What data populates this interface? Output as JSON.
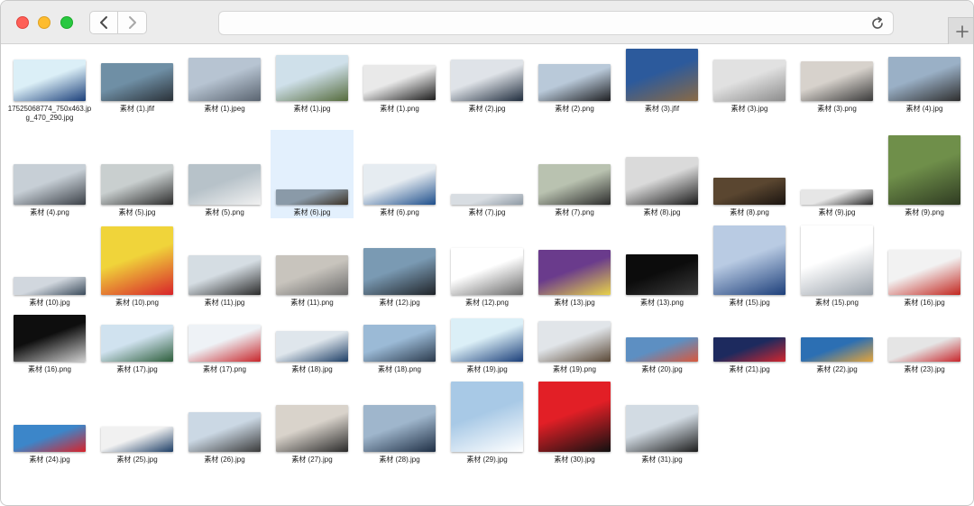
{
  "window": {
    "buttons": [
      "close",
      "minimize",
      "zoom"
    ],
    "back_icon": "chevron-left-icon",
    "forward_icon": "chevron-right-icon",
    "reload_icon": "reload-icon",
    "new_tab_icon": "plus-icon",
    "url": ""
  },
  "files": [
    {
      "name": "17525068774_750x463.jpg_470_290.jpg",
      "colors": [
        "#dbeff7",
        "#1b3f7a"
      ]
    },
    {
      "name": "素材 (1).jfif",
      "colors": [
        "#6f8fa5",
        "#2a3138"
      ]
    },
    {
      "name": "素材 (1).jpeg",
      "colors": [
        "#b7c4d2",
        "#5a6470"
      ]
    },
    {
      "name": "素材 (1).jpg",
      "colors": [
        "#cfe0ea",
        "#556b3c"
      ]
    },
    {
      "name": "素材 (1).png",
      "colors": [
        "#e9e9e9",
        "#1c1c1c"
      ]
    },
    {
      "name": "素材 (2).jpg",
      "colors": [
        "#dfe3e8",
        "#1f2c3d"
      ]
    },
    {
      "name": "素材 (2).png",
      "colors": [
        "#b9c9d9",
        "#1e1f22"
      ]
    },
    {
      "name": "素材 (3).jfif",
      "colors": [
        "#2c5a9c",
        "#8a6a45"
      ]
    },
    {
      "name": "素材 (3).jpg",
      "colors": [
        "#e1e1e1",
        "#8c8c8c"
      ]
    },
    {
      "name": "素材 (3).png",
      "colors": [
        "#d7d2cc",
        "#3a3a3a"
      ]
    },
    {
      "name": "素材 (4).jpg",
      "colors": [
        "#9ab0c6",
        "#2e2e2e"
      ]
    },
    {
      "name": "素材 (4).png",
      "colors": [
        "#c7cfd6",
        "#3b4047"
      ]
    },
    {
      "name": "素材 (5).jpg",
      "colors": [
        "#c9cfcf",
        "#2d2d2d"
      ]
    },
    {
      "name": "素材 (5).png",
      "colors": [
        "#b7c2c9",
        "#f1f1f1"
      ]
    },
    {
      "name": "素材 (6).jpg",
      "colors": [
        "#8a9aa8",
        "#3c3226"
      ]
    },
    {
      "name": "素材 (6).png",
      "colors": [
        "#e6ecf1",
        "#1e4f8c"
      ]
    },
    {
      "name": "素材 (7).jpg",
      "colors": [
        "#d8dde2",
        "#8f9aa5"
      ]
    },
    {
      "name": "素材 (7).png",
      "colors": [
        "#b9c2b0",
        "#2c2c2c"
      ]
    },
    {
      "name": "素材 (8).jpg",
      "colors": [
        "#dadada",
        "#1a1a1a"
      ]
    },
    {
      "name": "素材 (8).png",
      "colors": [
        "#5a4630",
        "#1a1410"
      ]
    },
    {
      "name": "素材 (9).jpg",
      "colors": [
        "#e6e6e6",
        "#2a2a2a"
      ]
    },
    {
      "name": "素材 (9).png",
      "colors": [
        "#6f8f4a",
        "#2f3b22"
      ]
    },
    {
      "name": "素材 (10).jpg",
      "colors": [
        "#d1d7de",
        "#3a4a5a"
      ]
    },
    {
      "name": "素材 (10).png",
      "colors": [
        "#f0d43a",
        "#d8232a"
      ]
    },
    {
      "name": "素材 (11).jpg",
      "colors": [
        "#d5dde3",
        "#2a2a2a"
      ]
    },
    {
      "name": "素材 (11).png",
      "colors": [
        "#c8c4bd",
        "#6a6a6a"
      ]
    },
    {
      "name": "素材 (12).jpg",
      "colors": [
        "#7a9ab3",
        "#1f2328"
      ]
    },
    {
      "name": "素材 (12).png",
      "colors": [
        "#ffffff",
        "#6a6a6a"
      ]
    },
    {
      "name": "素材 (13).jpg",
      "colors": [
        "#6a3b8c",
        "#e8d24a"
      ]
    },
    {
      "name": "素材 (13).png",
      "colors": [
        "#0c0c0c",
        "#3a3a3a"
      ]
    },
    {
      "name": "素材 (15).jpg",
      "colors": [
        "#b9cbe3",
        "#1d3f7a"
      ]
    },
    {
      "name": "素材 (15).png",
      "colors": [
        "#ffffff",
        "#9aa2ab"
      ]
    },
    {
      "name": "素材 (16).jpg",
      "colors": [
        "#f2f2f2",
        "#c2261f"
      ]
    },
    {
      "name": "素材 (16).png",
      "colors": [
        "#0e0e0e",
        "#cfcfcf"
      ]
    },
    {
      "name": "素材 (17).jpg",
      "colors": [
        "#d0e2ef",
        "#2d5e3b"
      ]
    },
    {
      "name": "素材 (17).png",
      "colors": [
        "#eef2f6",
        "#c8262b"
      ]
    },
    {
      "name": "素材 (18).jpg",
      "colors": [
        "#dfe6ec",
        "#1d3e66"
      ]
    },
    {
      "name": "素材 (18).png",
      "colors": [
        "#9bbad6",
        "#2b3a4c"
      ]
    },
    {
      "name": "素材 (19).jpg",
      "colors": [
        "#dbeff7",
        "#1b3f7a"
      ]
    },
    {
      "name": "素材 (19).png",
      "colors": [
        "#e1e5e9",
        "#5a4836"
      ]
    },
    {
      "name": "素材 (20).jpg",
      "colors": [
        "#5d8fc2",
        "#d9583c"
      ]
    },
    {
      "name": "素材 (21).jpg",
      "colors": [
        "#1d2a5e",
        "#d2262e"
      ]
    },
    {
      "name": "素材 (22).jpg",
      "colors": [
        "#2c6fb3",
        "#e4a43a"
      ]
    },
    {
      "name": "素材 (23).jpg",
      "colors": [
        "#e5e5e5",
        "#c8262b"
      ]
    },
    {
      "name": "素材 (24).jpg",
      "colors": [
        "#3c86c9",
        "#d8232a"
      ]
    },
    {
      "name": "素材 (25).jpg",
      "colors": [
        "#f1f1f1",
        "#1d3e66"
      ]
    },
    {
      "name": "素材 (26).jpg",
      "colors": [
        "#cbd8e4",
        "#3a3a3a"
      ]
    },
    {
      "name": "素材 (27).jpg",
      "colors": [
        "#d9d3cb",
        "#2a2a2a"
      ]
    },
    {
      "name": "素材 (28).jpg",
      "colors": [
        "#9fb6cc",
        "#1f2f45"
      ]
    },
    {
      "name": "素材 (29).jpg",
      "colors": [
        "#a8c9e6",
        "#ffffff"
      ]
    },
    {
      "name": "素材 (30).jpg",
      "colors": [
        "#e21f26",
        "#111111"
      ]
    },
    {
      "name": "素材 (31).jpg",
      "colors": [
        "#d2dbe3",
        "#1d1d1d"
      ]
    }
  ],
  "selected_file": "素材 (6).jpg"
}
